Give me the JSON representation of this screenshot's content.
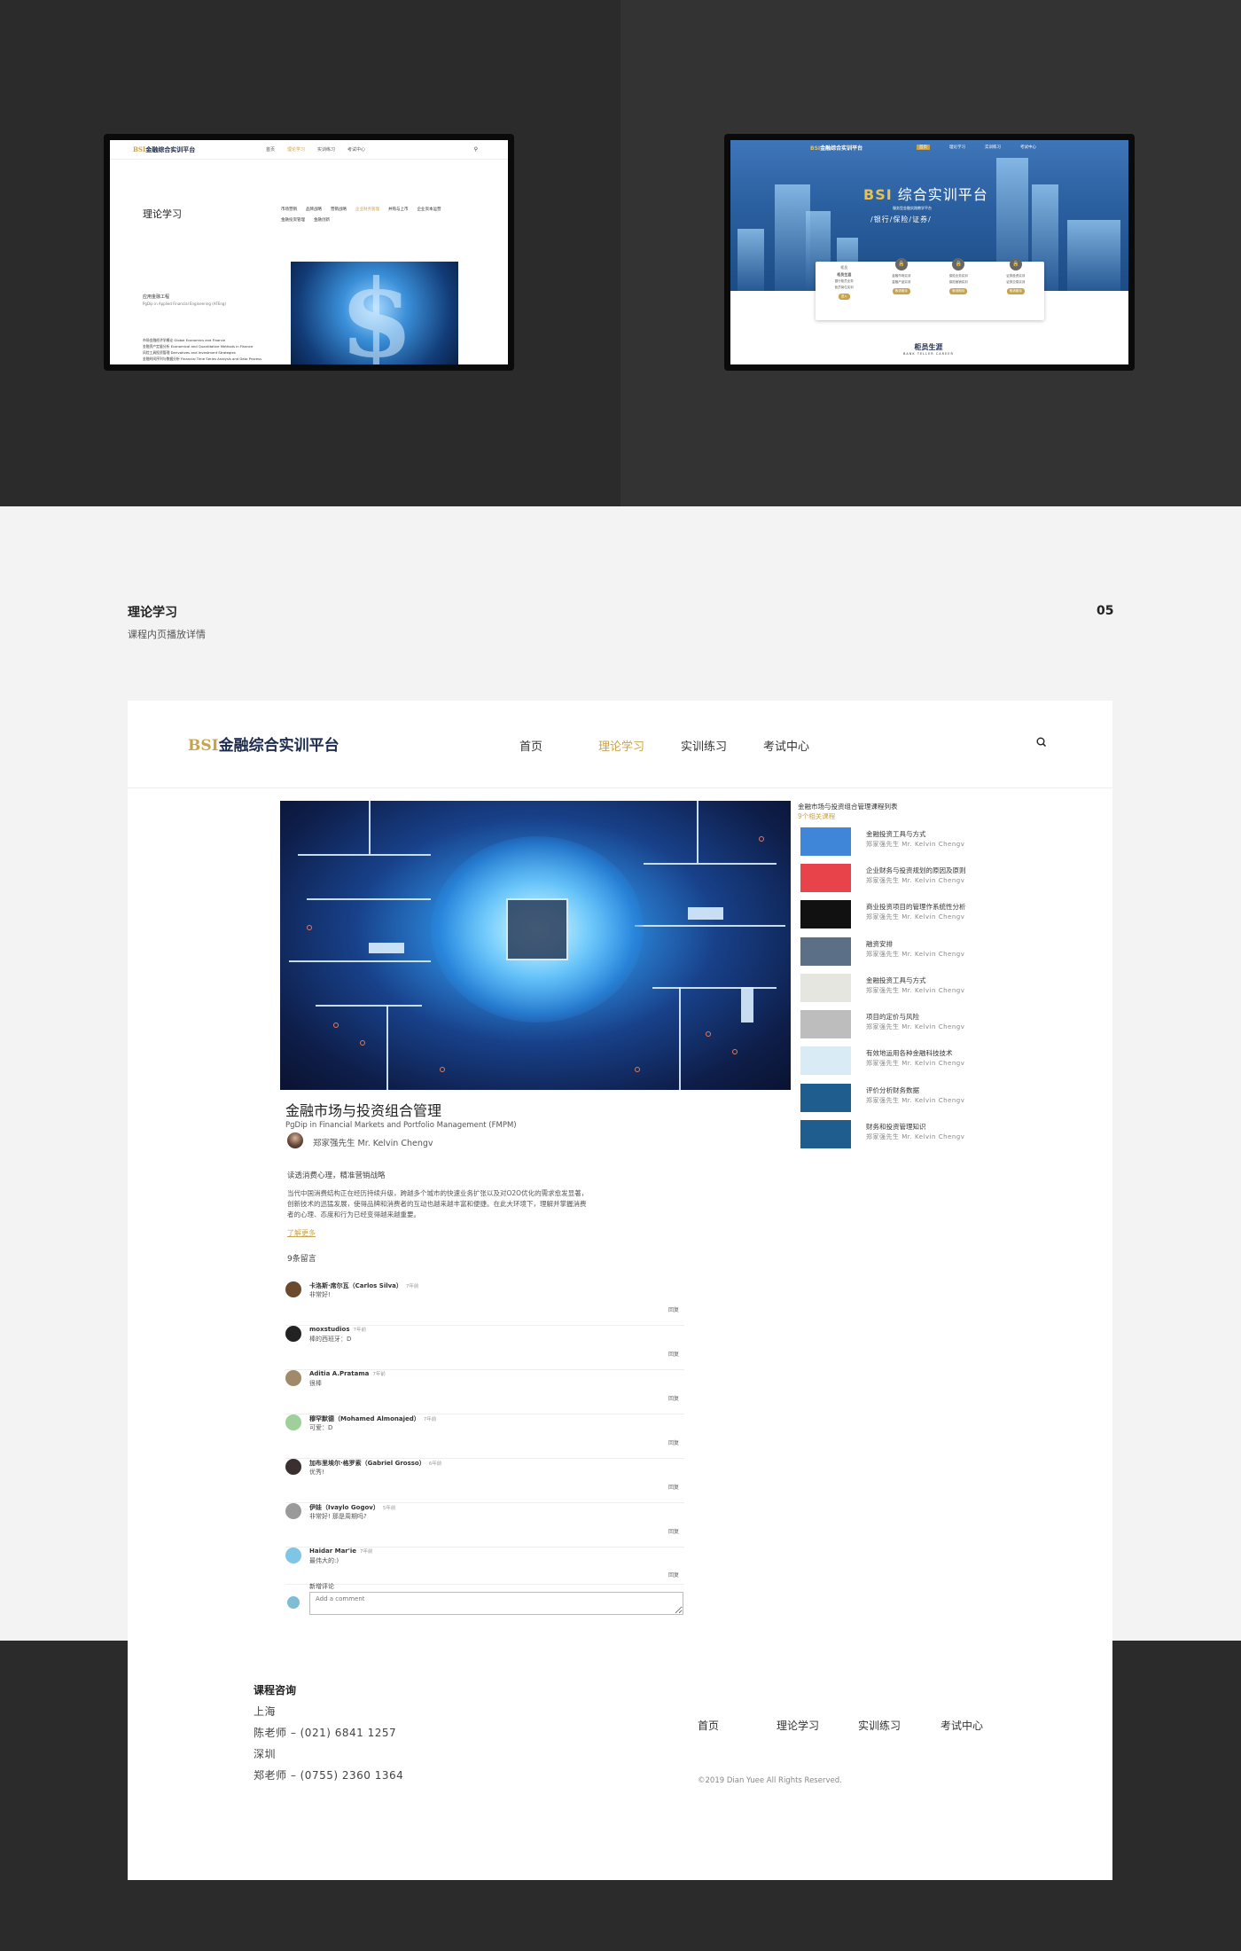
{
  "mini_left": {
    "logo": "BSI金融综合实训平台",
    "logo_prefix": "BSI",
    "logo_rest": "金融综合实训平台",
    "menu": [
      "首页",
      "理论学习",
      "实训练习",
      "考试中心"
    ],
    "title": "理论学习",
    "categories": [
      "市场营销",
      "品牌战略",
      "营销战略",
      "企业财务管理",
      "并购与上市",
      "企业资本运营",
      "金融投资管理",
      "金融创新"
    ],
    "program_title": "应用金融工程",
    "program_sub": "PgDip in Applied Financial Engineering (AFEng)",
    "program_list": [
      "市场金融经济学概论 Global Economics and Finance",
      "金融资产定量分析 Economical and Quantitative Methods in Finance",
      "风险工具投资管理 Derivatives and Investment Strategies",
      "金融时间序列与数据分析 Financial Time Series Analysis and Data Process"
    ]
  },
  "mini_right": {
    "logo_prefix": "BSI",
    "logo_rest": "金融综合实训平台",
    "menu": [
      "首页",
      "理论学习",
      "实训练习",
      "考试中心"
    ],
    "hero_title_prefix": "BSI",
    "hero_title_rest": "综合实训平台",
    "hero_sub": "服务型金融实践教学平台",
    "hero_tags": "/银行/保险/证券/",
    "cards": [
      {
        "top": "柜员",
        "mid": "柜员生涯",
        "lines": [
          "银行柜员业务",
          "柜员岗位实训"
        ],
        "pill": "进入"
      },
      {
        "top": "🔒",
        "mid": "",
        "lines": [
          "金融市场实训",
          "金融产品实训"
        ],
        "pill": "敬请期待"
      },
      {
        "top": "🔒",
        "mid": "",
        "lines": [
          "保险业务实训",
          "保险营销实训"
        ],
        "pill": "敬请期待"
      },
      {
        "top": "🔒",
        "mid": "",
        "lines": [
          "证券投资实训",
          "证券交易实训"
        ],
        "pill": "敬请期待"
      }
    ],
    "teller_cn": "柜员生涯",
    "teller_en": "BANK TELLER CAREER"
  },
  "section": {
    "title": "理论学习",
    "subtitle": "课程内页播放详情",
    "number": "05"
  },
  "nav": {
    "logo_prefix": "BSI",
    "logo_rest": "金融综合实训平台",
    "items": [
      "首页",
      "理论学习",
      "实训练习",
      "考试中心"
    ],
    "active": "理论学习"
  },
  "course": {
    "title": "金融市场与投资组合管理",
    "subtitle_en": "PgDip in Financial Markets and Portfolio Management (FMPM)",
    "teacher": "郑家强先生 Mr. Kelvin Chengv",
    "intro_title": "读透消费心理，精准营销战略",
    "intro_body": "当代中国消费结构正在经历持续升级，跨越多个城市的快速业务扩张以及对O2O优化的需求愈发显著，创新技术的迅猛发展，使得品牌和消费者的互动也越来越丰富和便捷。在此大环境下，理解并掌握消费者的心理、态度和行为已经变得越来越重要。",
    "more": "了解更多",
    "comments_count": "9条留言"
  },
  "comments": [
    {
      "name": "卡洛斯·席尔瓦（Carlos Silva）",
      "time": "7年前",
      "text": "非常好!",
      "reply": "回复",
      "avatar_color": "#6b4a2e"
    },
    {
      "name": "moxstudios",
      "time": "7年前",
      "text": "棒的西班牙：D",
      "reply": "回复",
      "avatar_color": "#222222"
    },
    {
      "name": "Aditia A.Pratama",
      "time": "7年前",
      "text": "很棒",
      "reply": "回复",
      "avatar_color": "#a08a6a"
    },
    {
      "name": "穆罕默德（Mohamed Almonajed）",
      "time": "7年前",
      "text": "可爱：D",
      "reply": "回复",
      "avatar_color": "#9fcf9a"
    },
    {
      "name": "加布里埃尔·格罗索（Gabriel Grosso）",
      "time": "6年前",
      "text": "优秀!",
      "reply": "回复",
      "avatar_color": "#3a3030"
    },
    {
      "name": "伊娃（Ivaylo Gogov）",
      "time": "5年前",
      "text": "非常好! 那是周期吗?",
      "reply": "回复",
      "avatar_color": "#9a9a9a"
    },
    {
      "name": "Haidar Mar'ie",
      "time": "7年前",
      "text": "最伟大的:)",
      "reply": "回复",
      "avatar_color": "#7fc6e6"
    }
  ],
  "new_comment": {
    "label": "新增评论",
    "placeholder": "Add a comment"
  },
  "sidebar": {
    "title": "金融市场与投资组合管理课程列表",
    "count": "9个相关课程",
    "items": [
      {
        "name": "金融投资工具与方式",
        "teacher": "郑家强先生 Mr. Kelvin Chengv",
        "color": "#3f86d8"
      },
      {
        "name": "企业财务与投资规划的原因及原则",
        "teacher": "郑家强先生 Mr. Kelvin Chengv",
        "color": "#e8434a"
      },
      {
        "name": "商业投资项目的管理作系统性分析",
        "teacher": "郑家强先生 Mr. Kelvin Chengv",
        "color": "#111111"
      },
      {
        "name": "融资安排",
        "teacher": "郑家强先生 Mr. Kelvin Chengv",
        "color": "#5b6f86"
      },
      {
        "name": "金融投资工具与方式",
        "teacher": "郑家强先生 Mr. Kelvin Chengv",
        "color": "#e6e6e0"
      },
      {
        "name": "项目的定价与风险",
        "teacher": "郑家强先生 Mr. Kelvin Chengv",
        "color": "#bdbdbd"
      },
      {
        "name": "有效地运用各种金融科技技术",
        "teacher": "郑家强先生 Mr. Kelvin Chengv",
        "color": "#d9ecf5"
      },
      {
        "name": "评价分析财务数据",
        "teacher": "郑家强先生 Mr. Kelvin Chengv",
        "color": "#1f5d8e"
      },
      {
        "name": "财务和投资管理知识",
        "teacher": "郑家强先生 Mr. Kelvin Chengv",
        "color": "#1f5d8e"
      }
    ]
  },
  "footer": {
    "title": "课程咨询",
    "lines": [
      "上海",
      "陈老师 – (021) 6841 1257",
      "深圳",
      "郑老师 – (0755) 2360 1364"
    ],
    "menu": [
      "首页",
      "理论学习",
      "实训练习",
      "考试中心"
    ],
    "copyright": "©2019 Dian Yuee  All Rights Reserved."
  }
}
